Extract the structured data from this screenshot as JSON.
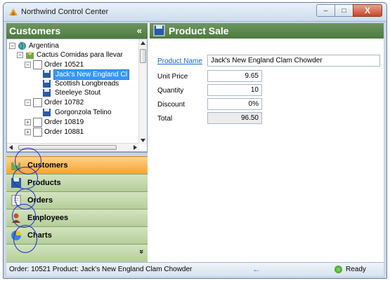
{
  "window": {
    "title": "Northwind Control Center",
    "controls": {
      "minimize": "‒",
      "maximize": "□",
      "close": "X"
    }
  },
  "left": {
    "header": "Customers",
    "collapse": "«",
    "tree": [
      {
        "label": "Argentina",
        "expander": "−"
      },
      {
        "label": "Cactus Comidas para llevar",
        "expander": "−"
      },
      {
        "label": "Order 10521",
        "expander": "−"
      },
      {
        "label": "Jack's New England Cl"
      },
      {
        "label": "Scottish Longbreads"
      },
      {
        "label": "Steeleye Stout"
      },
      {
        "label": "Order 10782",
        "expander": "−"
      },
      {
        "label": "Gorgonzola Telino"
      },
      {
        "label": "Order 10819",
        "expander": "+"
      },
      {
        "label": "Order 10881",
        "expander": "+"
      }
    ],
    "nav": [
      {
        "label": "Customers"
      },
      {
        "label": "Products"
      },
      {
        "label": "Orders"
      },
      {
        "label": "Employees"
      },
      {
        "label": "Charts"
      }
    ],
    "more": "»"
  },
  "right": {
    "header": "Product Sale",
    "fields": [
      {
        "label": "Product Name",
        "value": "Jack's New England Clam Chowder"
      },
      {
        "label": "Unit Price",
        "value": "9.65"
      },
      {
        "label": "Quantity",
        "value": "10"
      },
      {
        "label": "Discount",
        "value": "0%"
      },
      {
        "label": "Total",
        "value": "96.50"
      }
    ]
  },
  "status": {
    "text": "Order: 10521 Product: Jack's New England Clam Chowder",
    "ready": "Ready"
  }
}
